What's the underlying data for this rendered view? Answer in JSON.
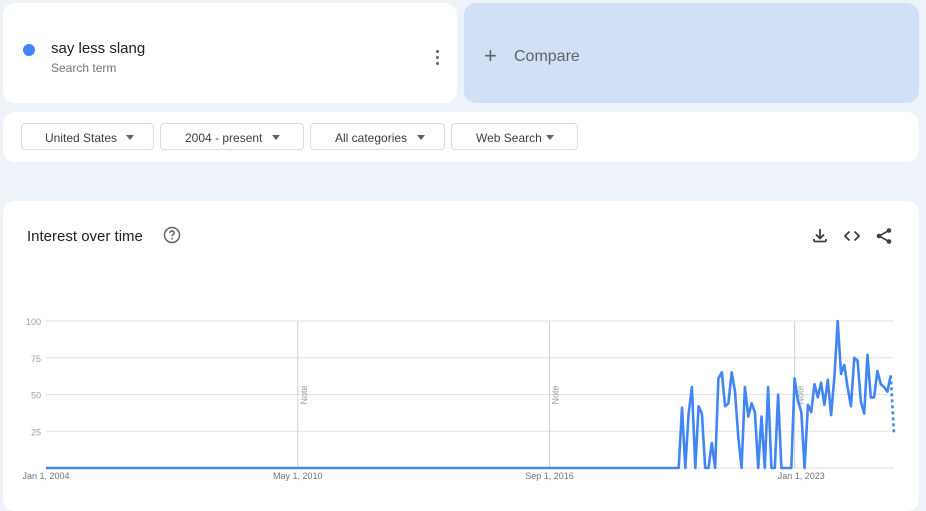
{
  "search_term": {
    "name": "say less slang",
    "subtitle": "Search term",
    "color": "#4285f4"
  },
  "compare": {
    "label": "Compare"
  },
  "filters": {
    "region": "United States",
    "period": "2004 - present",
    "category": "All categories",
    "property": "Web Search"
  },
  "chart_panel": {
    "title": "Interest over time",
    "icons": [
      "help-icon",
      "download-icon",
      "embed-icon",
      "share-icon"
    ]
  },
  "chart_data": {
    "type": "line",
    "title": "Interest over time",
    "xlabel": "",
    "ylabel": "",
    "ylim": [
      0,
      100
    ],
    "y_ticks": [
      25,
      50,
      75,
      100
    ],
    "x_ticks": [
      "Jan 1, 2004",
      "May 1, 2010",
      "Sep 1, 2016",
      "Jan 1, 2023"
    ],
    "annotations": [
      {
        "date": "2010-05",
        "label": "Note"
      },
      {
        "date": "2016-09",
        "label": "Note"
      },
      {
        "date": "2022-11",
        "label": "Note"
      }
    ],
    "grid": true,
    "legend": "none",
    "line_color": "#4285f4",
    "x_start": "2004-01",
    "series": [
      {
        "values_note": "monthly values from 2004-01 through 2019-11 are 0",
        "points": [
          [
            "2019-12",
            0
          ],
          [
            "2020-01",
            41
          ],
          [
            "2020-02",
            0
          ],
          [
            "2020-03",
            37
          ],
          [
            "2020-04",
            55
          ],
          [
            "2020-05",
            0
          ],
          [
            "2020-06",
            42
          ],
          [
            "2020-07",
            37
          ],
          [
            "2020-08",
            0
          ],
          [
            "2020-09",
            0
          ],
          [
            "2020-10",
            17
          ],
          [
            "2020-11",
            0
          ],
          [
            "2020-12",
            61
          ],
          [
            "2021-01",
            65
          ],
          [
            "2021-02",
            42
          ],
          [
            "2021-03",
            44
          ],
          [
            "2021-04",
            65
          ],
          [
            "2021-05",
            52
          ],
          [
            "2021-06",
            21
          ],
          [
            "2021-07",
            0
          ],
          [
            "2021-08",
            55
          ],
          [
            "2021-09",
            35
          ],
          [
            "2021-10",
            44
          ],
          [
            "2021-11",
            38
          ],
          [
            "2021-12",
            0
          ],
          [
            "2022-01",
            35
          ],
          [
            "2022-02",
            0
          ],
          [
            "2022-03",
            55
          ],
          [
            "2022-04",
            0
          ],
          [
            "2022-05",
            0
          ],
          [
            "2022-06",
            50
          ],
          [
            "2022-07",
            0
          ],
          [
            "2022-08",
            0
          ],
          [
            "2022-09",
            0
          ],
          [
            "2022-10",
            0
          ],
          [
            "2022-11",
            61
          ],
          [
            "2022-12",
            46
          ],
          [
            "2023-01",
            38
          ],
          [
            "2023-02",
            0
          ],
          [
            "2023-03",
            43
          ],
          [
            "2023-04",
            38
          ],
          [
            "2023-05",
            57
          ],
          [
            "2023-06",
            48
          ],
          [
            "2023-07",
            58
          ],
          [
            "2023-08",
            43
          ],
          [
            "2023-09",
            60
          ],
          [
            "2023-10",
            36
          ],
          [
            "2023-11",
            62
          ],
          [
            "2023-12",
            100
          ],
          [
            "2024-01",
            64
          ],
          [
            "2024-02",
            70
          ],
          [
            "2024-03",
            55
          ],
          [
            "2024-04",
            42
          ],
          [
            "2024-05",
            75
          ],
          [
            "2024-06",
            73
          ],
          [
            "2024-07",
            45
          ],
          [
            "2024-08",
            37
          ],
          [
            "2024-09",
            77
          ],
          [
            "2024-10",
            48
          ],
          [
            "2024-11",
            48
          ],
          [
            "2024-12",
            66
          ],
          [
            "2025-01",
            57
          ],
          [
            "2025-02",
            55
          ],
          [
            "2025-03",
            52
          ],
          [
            "2025-04",
            63
          ]
        ],
        "partial_last": [
          "2025-05",
          23
        ]
      }
    ]
  }
}
